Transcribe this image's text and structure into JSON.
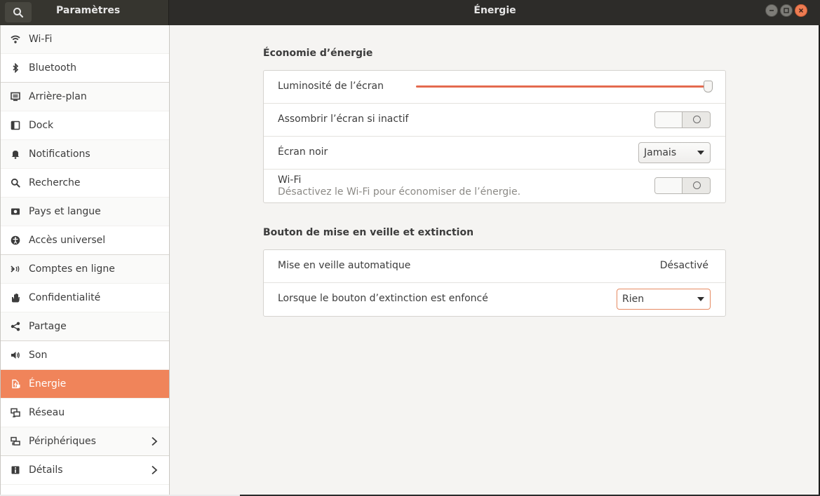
{
  "header": {
    "app_title": "Paramètres",
    "panel_title": "Énergie"
  },
  "sidebar": {
    "items": [
      {
        "label": "Wi-Fi",
        "icon": "wifi-icon"
      },
      {
        "label": "Bluetooth",
        "icon": "bluetooth-icon"
      },
      {
        "label": "Arrière-plan",
        "icon": "background-icon"
      },
      {
        "label": "Dock",
        "icon": "dock-icon"
      },
      {
        "label": "Notifications",
        "icon": "bell-icon"
      },
      {
        "label": "Recherche",
        "icon": "search-icon"
      },
      {
        "label": "Pays et langue",
        "icon": "region-icon"
      },
      {
        "label": "Accès universel",
        "icon": "accessibility-icon"
      },
      {
        "label": "Comptes en ligne",
        "icon": "online-accounts-icon"
      },
      {
        "label": "Confidentialité",
        "icon": "privacy-hand-icon"
      },
      {
        "label": "Partage",
        "icon": "share-icon"
      },
      {
        "label": "Son",
        "icon": "speaker-icon"
      },
      {
        "label": "Énergie",
        "icon": "power-icon"
      },
      {
        "label": "Réseau",
        "icon": "network-icon"
      },
      {
        "label": "Périphériques",
        "icon": "devices-icon"
      },
      {
        "label": "Détails",
        "icon": "info-icon"
      }
    ],
    "active_index": 12
  },
  "power_saving": {
    "title": "Économie d’énergie",
    "brightness_label": "Luminosité de l’écran",
    "brightness_level": 1.0,
    "dim_label": "Assombrir l’écran si inactif",
    "dim_enabled": false,
    "blank_label": "Écran noir",
    "blank_value": "Jamais",
    "wifi_label": "Wi-Fi",
    "wifi_sub": "Désactivez le Wi-Fi pour économiser de l’énergie.",
    "wifi_enabled": false
  },
  "suspend": {
    "title": "Bouton de mise en veille et extinction",
    "auto_suspend_label": "Mise en veille automatique",
    "auto_suspend_value": "Désactivé",
    "power_button_label": "Lorsque le bouton d’extinction est enfoncé",
    "power_button_value": "Rien"
  },
  "colors": {
    "accent": "#f0845a",
    "slider": "#e46a4f",
    "titlebar": "#2d2c29"
  }
}
